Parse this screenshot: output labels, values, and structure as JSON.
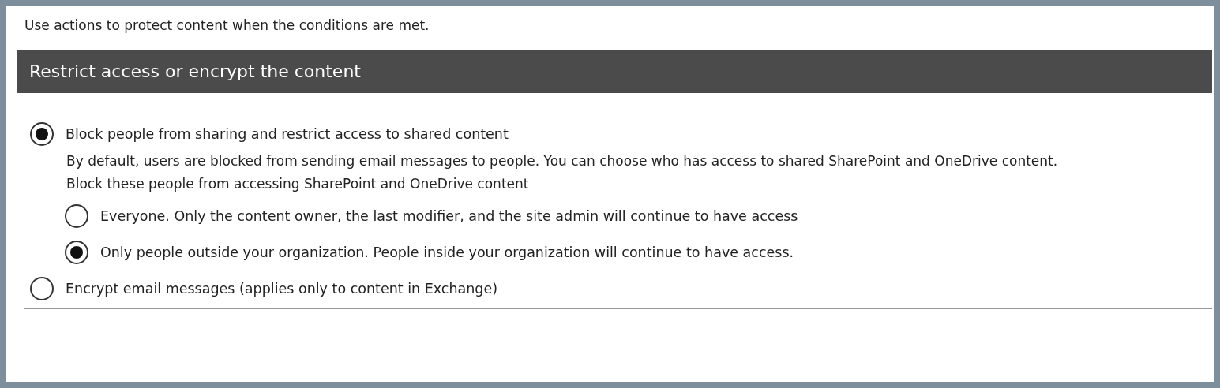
{
  "intro": "Use actions to protect content when the conditions are met.",
  "section": {
    "title": "Restrict access or encrypt the content"
  },
  "options": [
    {
      "label": "Block people from sharing and restrict access to shared content",
      "selected": true,
      "description": "By default, users are blocked from sending email messages to people. You can choose who has access to shared SharePoint and OneDrive content.",
      "sub_label": "Block these people from accessing SharePoint and OneDrive content",
      "children": [
        {
          "label": "Everyone. Only the content owner, the last modifier, and the site admin will continue to have access",
          "selected": false
        },
        {
          "label": "Only people outside your organization. People inside your organization will continue to have access.",
          "selected": true
        }
      ]
    },
    {
      "label": "Encrypt email messages (applies only to content in Exchange)",
      "selected": false
    }
  ]
}
